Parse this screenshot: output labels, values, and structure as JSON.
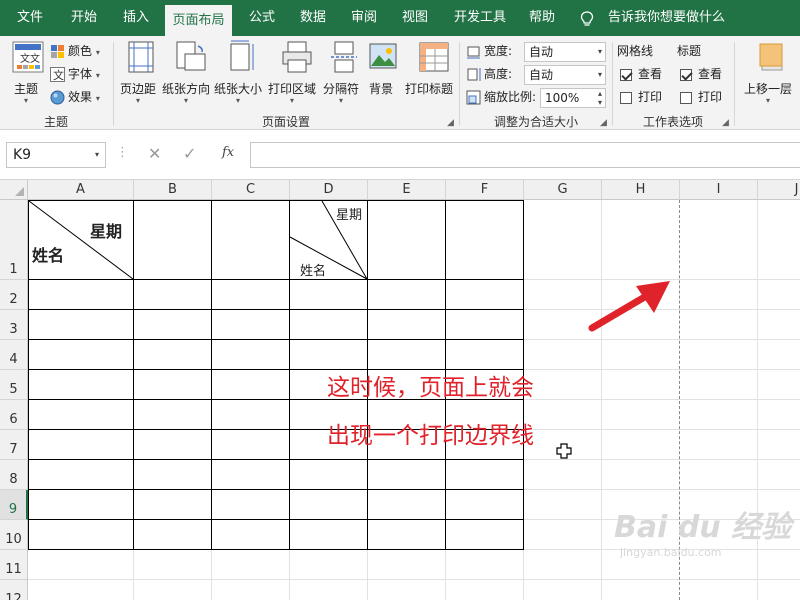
{
  "tabs": [
    "文件",
    "开始",
    "插入",
    "页面布局",
    "公式",
    "数据",
    "审阅",
    "视图",
    "开发工具",
    "帮助"
  ],
  "active_tab": "页面布局",
  "tell_me": "告诉我你想要做什么",
  "ribbon": {
    "theme_group": {
      "label": "主题",
      "theme_button": "主题",
      "colors": "颜色",
      "fonts": "字体",
      "effects": "效果"
    },
    "page_setup_group": {
      "label": "页面设置",
      "buttons": [
        "页边距",
        "纸张方向",
        "纸张大小",
        "打印区域",
        "分隔符",
        "背景",
        "打印标题"
      ]
    },
    "scale_group": {
      "label": "调整为合适大小",
      "width_label": "宽度:",
      "width_value": "自动",
      "height_label": "高度:",
      "height_value": "自动",
      "scale_label": "缩放比例:",
      "scale_value": "100%"
    },
    "sheet_options_group": {
      "label": "工作表选项",
      "gridlines": "网格线",
      "headings": "标题",
      "view": "查看",
      "print": "打印",
      "gridlines_view_checked": true,
      "gridlines_print_checked": false,
      "headings_view_checked": true,
      "headings_print_checked": false
    },
    "arrange_group": {
      "bring_forward": "上移一层"
    }
  },
  "formula_bar": {
    "name_box": "K9",
    "fx_label": "fx",
    "formula": ""
  },
  "grid": {
    "columns": [
      "A",
      "B",
      "C",
      "D",
      "E",
      "F",
      "G",
      "H",
      "I",
      "J"
    ],
    "rows": [
      "1",
      "2",
      "3",
      "4",
      "5",
      "6",
      "7",
      "8",
      "9",
      "10",
      "11",
      "12"
    ],
    "selected_row": "9",
    "cells": {
      "a1_top": "星期",
      "a1_bottom": "姓名",
      "d1_top": "星期",
      "d1_bottom": "姓名"
    }
  },
  "annotation": {
    "line1": "这时候，页面上就会",
    "line2": "出现一个打印边界线",
    "color": "#e0222a"
  },
  "watermark": {
    "logo": "Bai du 经验",
    "url": "jingyan.baidu.com"
  },
  "colors": {
    "ribbon_green": "#217346",
    "page_break": "#8a8a8a"
  }
}
